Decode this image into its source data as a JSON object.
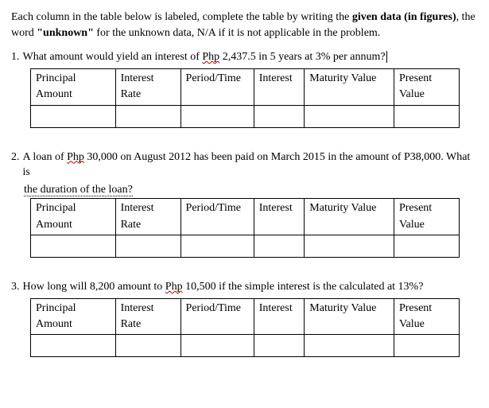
{
  "instructions": {
    "part1": "Each column in the table below is labeled, complete the table by writing the ",
    "bold1": "given data (in figures)",
    "part2": ", the word ",
    "bold2": "\"unknown\"",
    "part3": " for the unknown data, N/A if it is not applicable in the problem."
  },
  "headers": {
    "principal1": "Principal",
    "principal2": "Amount",
    "rate1": "Interest",
    "rate2": "Rate",
    "period": "Period/Time",
    "interest": "Interest",
    "maturity": "Maturity Value",
    "present1": "Present",
    "present2": "Value"
  },
  "problems": [
    {
      "number": "1.",
      "pre": "What amount would yield an interest of ",
      "wavy": "Php",
      "post": " 2,437.5 in 5 years at 3% per annum?",
      "subtext": ""
    },
    {
      "number": "2.",
      "pre": "A loan of ",
      "wavy": "Php",
      "post": " 30,000 on August 2012 has been paid on March 2015 in the amount of P38,000. What is",
      "subtext": "the duration of the loan?"
    },
    {
      "number": "3.",
      "pre": "How long will 8,200 amount to ",
      "wavy": "Php",
      "post": " 10,500 if the simple interest is the calculated at 13%?",
      "subtext": ""
    }
  ]
}
